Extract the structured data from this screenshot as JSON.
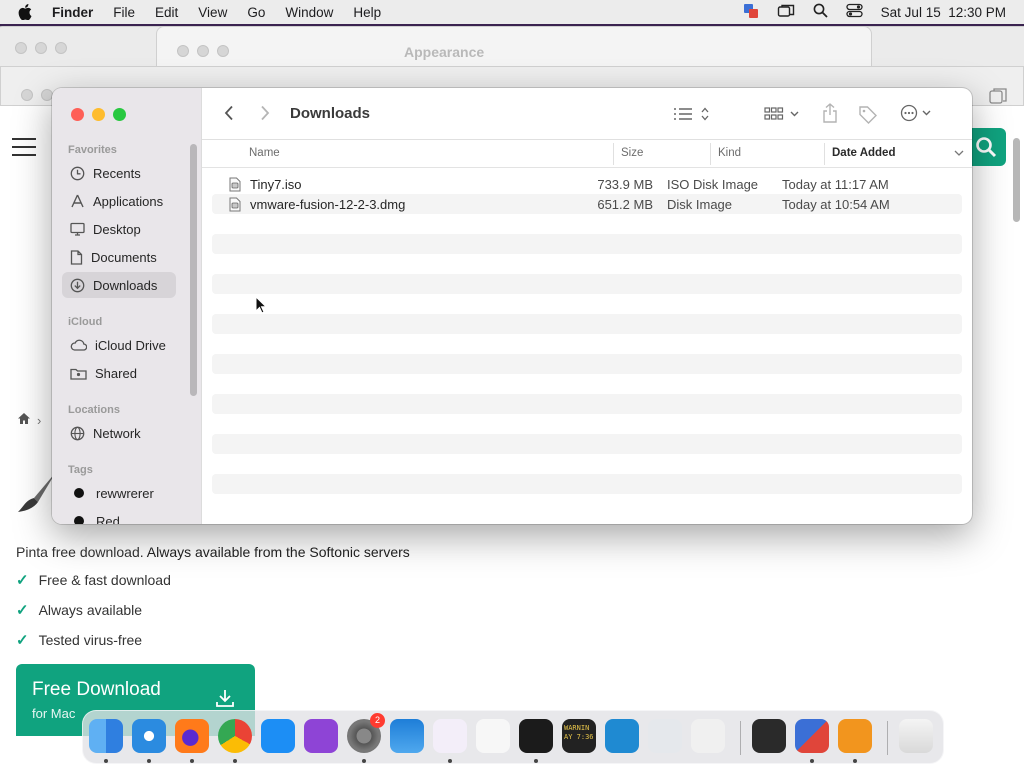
{
  "menubar": {
    "app_name": "Finder",
    "menus": [
      "File",
      "Edit",
      "View",
      "Go",
      "Window",
      "Help"
    ],
    "clock": "Sat Jul 15  12:30 PM"
  },
  "background_window": {
    "title": "Appearance"
  },
  "browser_page": {
    "description_prefix": "Pinta free download.",
    "description_rest": "Always available from the Softonic servers",
    "features": [
      "Free & fast download",
      "Always available",
      "Tested virus-free"
    ],
    "download_button": {
      "label": "Free Download",
      "sublabel": "for Mac"
    },
    "accent_color": "#10a37f"
  },
  "finder": {
    "title": "Downloads",
    "sidebar": {
      "favorites_header": "Favorites",
      "favorites": [
        {
          "label": "Recents",
          "icon": "clock-icon"
        },
        {
          "label": "Applications",
          "icon": "applications-icon"
        },
        {
          "label": "Desktop",
          "icon": "desktop-icon"
        },
        {
          "label": "Documents",
          "icon": "document-icon"
        },
        {
          "label": "Downloads",
          "icon": "download-icon",
          "selected": true
        }
      ],
      "icloud_header": "iCloud",
      "icloud": [
        {
          "label": "iCloud Drive",
          "icon": "cloud-icon"
        },
        {
          "label": "Shared",
          "icon": "shared-folder-icon"
        }
      ],
      "locations_header": "Locations",
      "locations": [
        {
          "label": "Network",
          "icon": "globe-icon"
        }
      ],
      "tags_header": "Tags",
      "tags": [
        {
          "label": "rewwrerer",
          "color": "#111111"
        },
        {
          "label": "Red",
          "color": "#111111"
        }
      ]
    },
    "columns": {
      "name": "Name",
      "size": "Size",
      "kind": "Kind",
      "date_added": "Date Added"
    },
    "files": [
      {
        "name": "Tiny7.iso",
        "size": "733.9 MB",
        "kind": "ISO Disk Image",
        "date_added": "Today at 11:17 AM"
      },
      {
        "name": "vmware-fusion-12-2-3.dmg",
        "size": "651.2 MB",
        "kind": "Disk Image",
        "date_added": "Today at 10:54 AM"
      }
    ]
  },
  "dock": {
    "apps": [
      "Finder",
      "Safari",
      "Firefox",
      "Chrome",
      "App Store",
      "Podcasts",
      "System Preferences",
      "Weather",
      "Visual Studio",
      "TextEdit",
      "Terminal",
      "Console",
      "VS Code",
      "Preview",
      "Launchpad",
      "Calculator",
      "VMware Fusion",
      "Books",
      "Trash"
    ],
    "system_prefs_badge": "2",
    "console_label": "WARNIN\nAY 7:36"
  }
}
